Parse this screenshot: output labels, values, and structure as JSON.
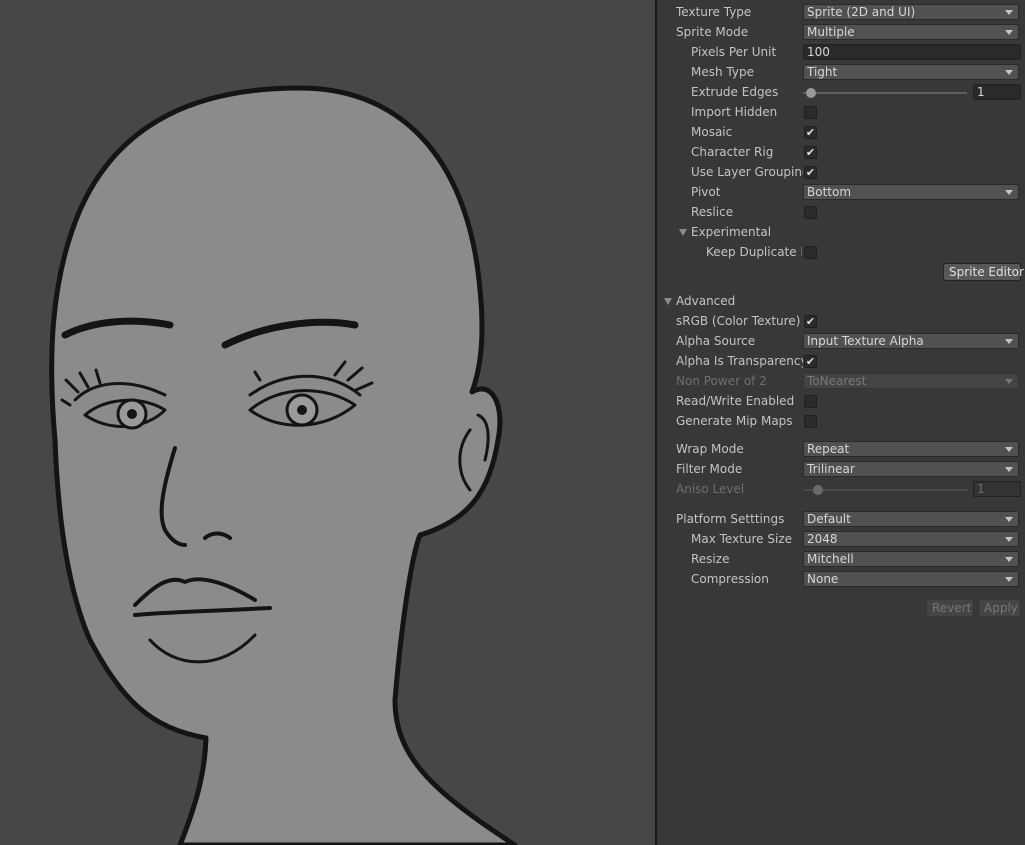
{
  "import_settings": {
    "texture_type": {
      "label": "Texture Type",
      "value": "Sprite (2D and UI)"
    },
    "sprite_mode": {
      "label": "Sprite Mode",
      "value": "Multiple"
    },
    "pixels_per_unit": {
      "label": "Pixels Per Unit",
      "value": "100"
    },
    "mesh_type": {
      "label": "Mesh Type",
      "value": "Tight"
    },
    "extrude_edges": {
      "label": "Extrude Edges",
      "value": "1"
    },
    "import_hidden": {
      "label": "Import Hidden",
      "checked": false
    },
    "mosaic": {
      "label": "Mosaic",
      "checked": true
    },
    "character_rig": {
      "label": "Character Rig",
      "checked": true
    },
    "use_layer_grouping": {
      "label": "Use Layer Grouping",
      "checked": true
    },
    "pivot": {
      "label": "Pivot",
      "value": "Bottom"
    },
    "reslice": {
      "label": "Reslice",
      "checked": false
    },
    "experimental": {
      "label": "Experimental",
      "expanded": true
    },
    "keep_duplicate": {
      "label": "Keep Duplicate N",
      "checked": false
    },
    "sprite_editor_button": "Sprite Editor"
  },
  "advanced": {
    "label": "Advanced",
    "expanded": true,
    "srgb": {
      "label": "sRGB (Color Texture)",
      "checked": true
    },
    "alpha_source": {
      "label": "Alpha Source",
      "value": "Input Texture Alpha"
    },
    "alpha_is_transparency": {
      "label": "Alpha Is Transparency",
      "checked": true
    },
    "non_power_of_2": {
      "label": "Non Power of 2",
      "value": "ToNearest",
      "disabled": true
    },
    "read_write_enabled": {
      "label": "Read/Write Enabled",
      "checked": false
    },
    "generate_mip_maps": {
      "label": "Generate Mip Maps",
      "checked": false
    }
  },
  "wrap_mode": {
    "label": "Wrap Mode",
    "value": "Repeat"
  },
  "filter_mode": {
    "label": "Filter Mode",
    "value": "Trilinear"
  },
  "aniso_level": {
    "label": "Aniso Level",
    "value": "1",
    "disabled": true
  },
  "platform": {
    "platform_settings": {
      "label": "Platform Setttings",
      "value": "Default"
    },
    "max_texture_size": {
      "label": "Max Texture Size",
      "value": "2048"
    },
    "resize": {
      "label": "Resize",
      "value": "Mitchell"
    },
    "compression": {
      "label": "Compression",
      "value": "None"
    }
  },
  "footer": {
    "revert": "Revert",
    "apply": "Apply",
    "disabled": true
  },
  "colors": {
    "viewport_bg": "#474747",
    "panel_bg": "#383838",
    "face_fill": "#8c8c8c",
    "outline": "#151515"
  }
}
